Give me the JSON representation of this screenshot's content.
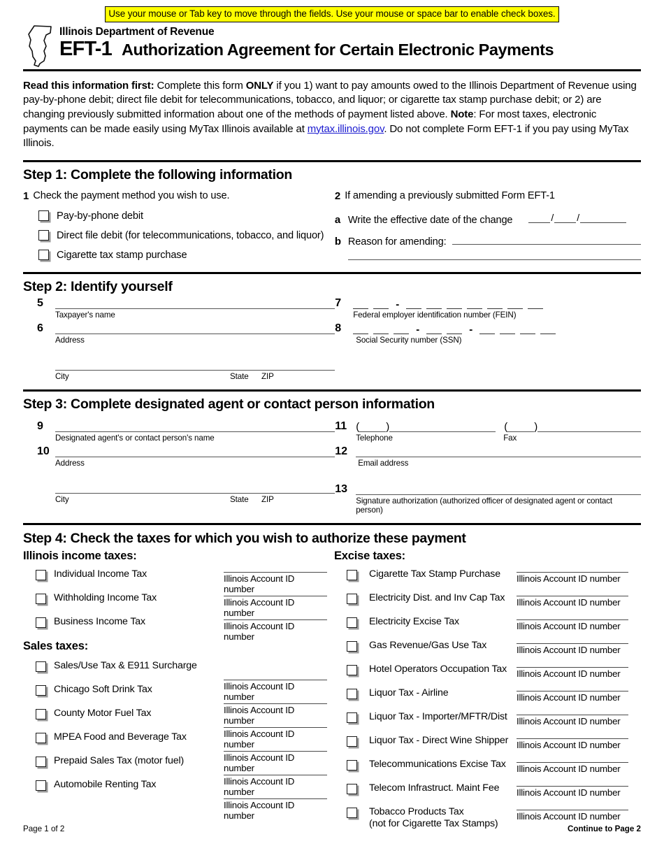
{
  "instruction_bar": {
    "text": "Use your mouse or Tab key to move through the fields. Use your mouse or space bar to enable check boxes.",
    "background_color": "#FFFF00"
  },
  "masthead": {
    "department": "Illinois Department of Revenue",
    "form_number": "EFT-1",
    "form_title": "Authorization Agreement for Certain Electronic Payments",
    "logo_name": "illinois-state-outline"
  },
  "intro": {
    "lead": "Read this information first:",
    "part1": " Complete this form ",
    "only": "ONLY",
    "part2": " if you 1) want to pay amounts owed to the Illinois Department of Revenue using pay-by-phone debit; direct file debit for telecommunications, tobacco, and liquor; or cigarette tax stamp purchase debit; or 2) are changing previously submitted information about one of the methods of payment listed above. ",
    "note": "Note",
    "part3": ": For most taxes, electronic payments can be made easily using MyTax Illinois available at ",
    "link": "mytax.illinois.gov",
    "part4": ". Do not complete Form EFT-1 if you pay using MyTax Illinois."
  },
  "step1": {
    "heading": "Step 1: Complete the following information",
    "item1_num": "1",
    "item1_label": "Check the payment method you wish to use.",
    "methods": [
      "Pay-by-phone debit",
      "Direct file debit (for telecommunications, tobacco, and liquor)",
      "Cigarette tax stamp purchase"
    ],
    "item2_num": "2",
    "item2_label": "If amending a previously submitted Form EFT-1",
    "item_a_num": "a",
    "item_a_label": "Write the effective date of the change",
    "item_b_num": "b",
    "item_b_label": "Reason for amending:"
  },
  "step2": {
    "heading": "Step 2: Identify yourself",
    "line5_num": "5",
    "line5_cap": "Taxpayer's name",
    "line6_num": "6",
    "line6_cap": "Address",
    "city_cap": "City",
    "state_cap": "State",
    "zip_cap": "ZIP",
    "line7_num": "7",
    "line7_cap": "Federal employer identification number (FEIN)",
    "line8_num": "8",
    "line8_cap": "Social Security number (SSN)"
  },
  "step3": {
    "heading": "Step 3:  Complete designated agent or contact person information",
    "line9_num": "9",
    "line9_cap": "Designated agent's or contact person's name",
    "line10_num": "10",
    "line10_cap": "Address",
    "city_cap": "City",
    "state_cap": "State",
    "zip_cap": "ZIP",
    "line11_num": "11",
    "telephone_cap": "Telephone",
    "fax_cap": "Fax",
    "line12_num": "12",
    "line12_cap": "Email address",
    "line13_num": "13",
    "line13_cap": "Signature authorization (authorized officer of designated agent or contact person)"
  },
  "step4": {
    "heading": "Step 4:  Check the taxes for which you wish to authorize these payment",
    "account_caption": "Illinois Account ID number",
    "left_groups": [
      {
        "title": "Illinois income taxes:",
        "items": [
          "Individual Income Tax",
          "Withholding Income Tax",
          "Business Income Tax"
        ]
      },
      {
        "title": "Sales taxes:",
        "items": [
          "Sales/Use Tax & E911 Surcharge",
          "Chicago Soft Drink Tax",
          "County Motor Fuel Tax",
          "MPEA Food and Beverage Tax",
          "Prepaid Sales Tax (motor fuel)",
          "Automobile Renting Tax"
        ]
      }
    ],
    "right_groups": [
      {
        "title": "Excise taxes:",
        "items": [
          "Cigarette Tax Stamp Purchase",
          "Electricity Dist. and Inv Cap Tax",
          "Electricity Excise Tax",
          "Gas Revenue/Gas Use Tax",
          "Hotel Operators Occupation Tax",
          "Liquor Tax - Airline",
          "Liquor Tax - Importer/MFTR/Dist",
          "Liquor Tax - Direct Wine Shipper",
          "Telecommunications Excise Tax",
          "Telecom Infrastruct. Maint Fee",
          "Tobacco Products Tax"
        ],
        "last_item_sub": "(not for Cigarette Tax Stamps)"
      }
    ]
  },
  "footer": {
    "page_label": "Page 1 of 2",
    "continue_label": "Continue to Page 2"
  }
}
